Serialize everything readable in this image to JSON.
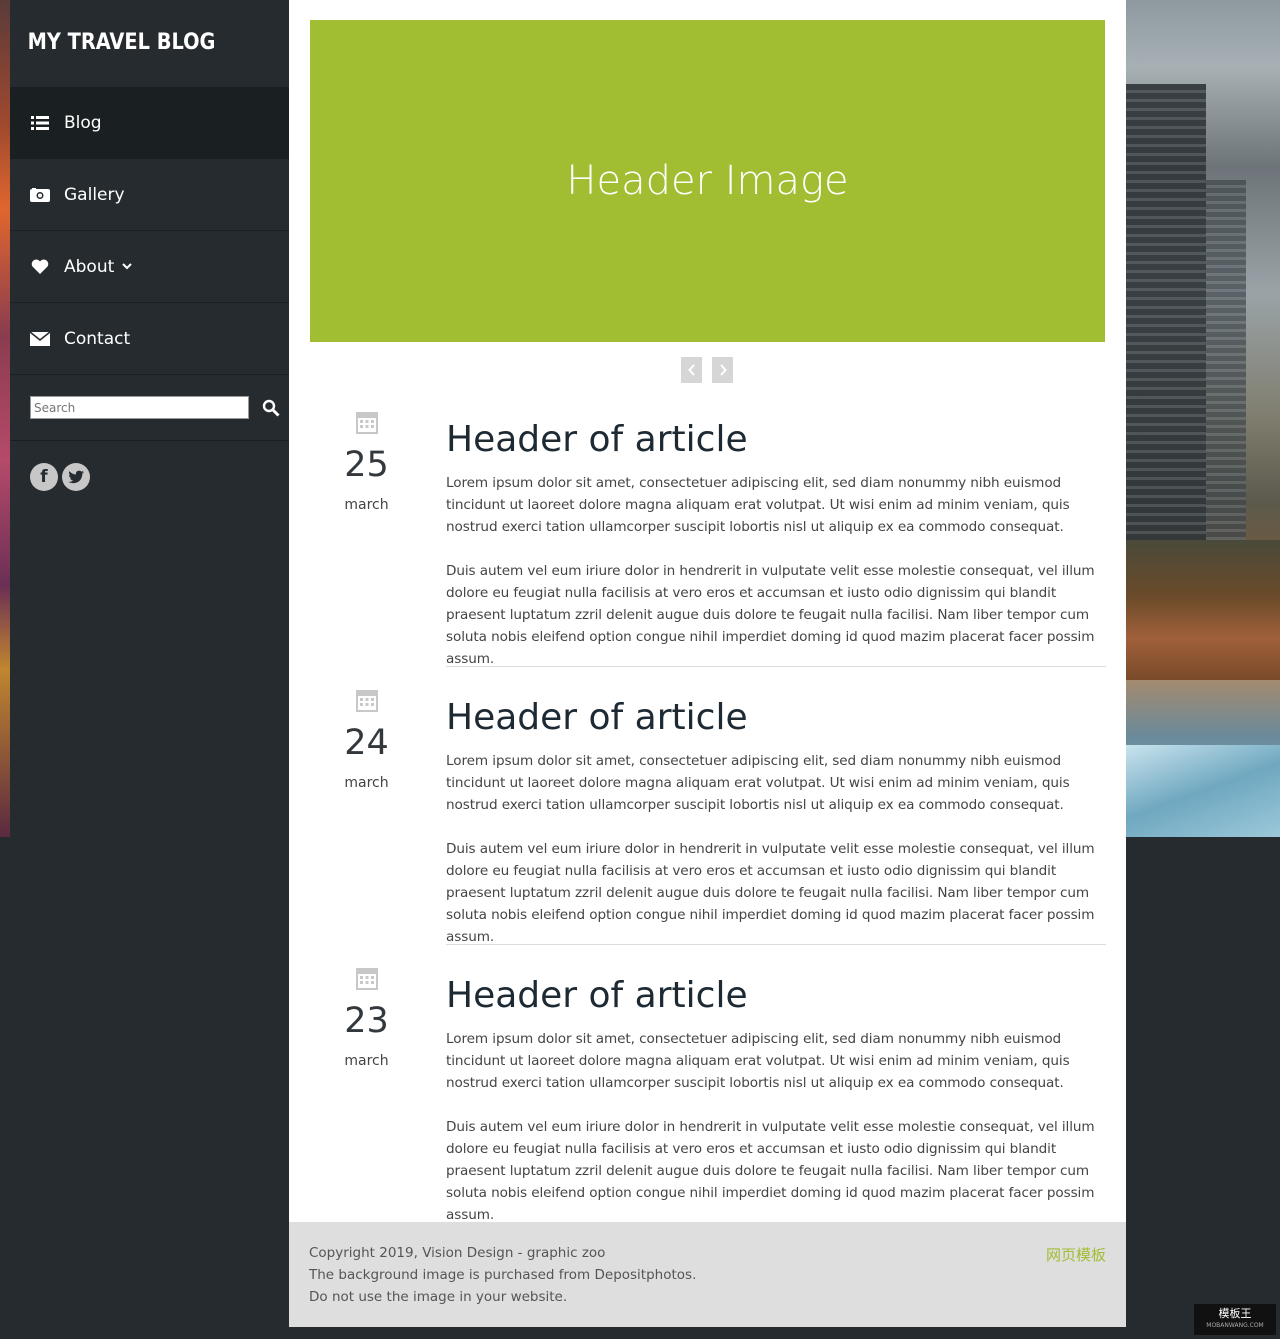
{
  "site": {
    "logo": "MY TRAVEL BLOG"
  },
  "sidebar": {
    "items": [
      {
        "label": "Blog",
        "icon": "list-icon",
        "active": true
      },
      {
        "label": "Gallery",
        "icon": "camera-icon",
        "active": false
      },
      {
        "label": "About",
        "icon": "heart-icon",
        "active": false
      },
      {
        "label": "Contact",
        "icon": "envelope-icon",
        "active": false
      }
    ],
    "search": {
      "placeholder": "Search"
    },
    "social": [
      "f",
      "t"
    ]
  },
  "hero": {
    "label": "Header Image"
  },
  "articles": [
    {
      "day": "25",
      "month": "march",
      "title": "Header of article",
      "p1": "Lorem ipsum dolor sit amet, consectetuer adipiscing elit, sed diam nonummy nibh euismod tincidunt ut laoreet dolore magna aliquam erat volutpat. Ut wisi enim ad minim veniam, quis nostrud exerci tation ullamcorper suscipit lobortis nisl ut aliquip ex ea commodo consequat.",
      "p2": "Duis autem vel eum iriure dolor in hendrerit in vulputate velit esse molestie consequat, vel illum dolore eu feugiat nulla facilisis at vero eros et accumsan et iusto odio dignissim qui blandit praesent luptatum zzril delenit augue duis dolore te feugait nulla facilisi. Nam liber tempor cum soluta nobis eleifend option congue nihil imperdiet doming id quod mazim placerat facer possim assum."
    },
    {
      "day": "24",
      "month": "march",
      "title": "Header of article",
      "p1": "Lorem ipsum dolor sit amet, consectetuer adipiscing elit, sed diam nonummy nibh euismod tincidunt ut laoreet dolore magna aliquam erat volutpat. Ut wisi enim ad minim veniam, quis nostrud exerci tation ullamcorper suscipit lobortis nisl ut aliquip ex ea commodo consequat.",
      "p2": "Duis autem vel eum iriure dolor in hendrerit in vulputate velit esse molestie consequat, vel illum dolore eu feugiat nulla facilisis at vero eros et accumsan et iusto odio dignissim qui blandit praesent luptatum zzril delenit augue duis dolore te feugait nulla facilisi. Nam liber tempor cum soluta nobis eleifend option congue nihil imperdiet doming id quod mazim placerat facer possim assum."
    },
    {
      "day": "23",
      "month": "march",
      "title": "Header of article",
      "p1": "Lorem ipsum dolor sit amet, consectetuer adipiscing elit, sed diam nonummy nibh euismod tincidunt ut laoreet dolore magna aliquam erat volutpat. Ut wisi enim ad minim veniam, quis nostrud exerci tation ullamcorper suscipit lobortis nisl ut aliquip ex ea commodo consequat.",
      "p2": "Duis autem vel eum iriure dolor in hendrerit in vulputate velit esse molestie consequat, vel illum dolore eu feugiat nulla facilisis at vero eros et accumsan et iusto odio dignissim qui blandit praesent luptatum zzril delenit augue duis dolore te feugait nulla facilisi. Nam liber tempor cum soluta nobis eleifend option congue nihil imperdiet doming id quod mazim placerat facer possim assum."
    }
  ],
  "footer": {
    "line1": "Copyright 2019, Vision Design - graphic zoo",
    "line2": "The background image is purchased from Depositphotos. Do not use the image in your website.",
    "link": "网页模板"
  },
  "watermark": {
    "title": "模板王",
    "sub": "MOBANWANG.COM"
  },
  "colors": {
    "accent": "#a1bd31",
    "sidebar": "#252b2f",
    "active": "#1a1f22"
  }
}
